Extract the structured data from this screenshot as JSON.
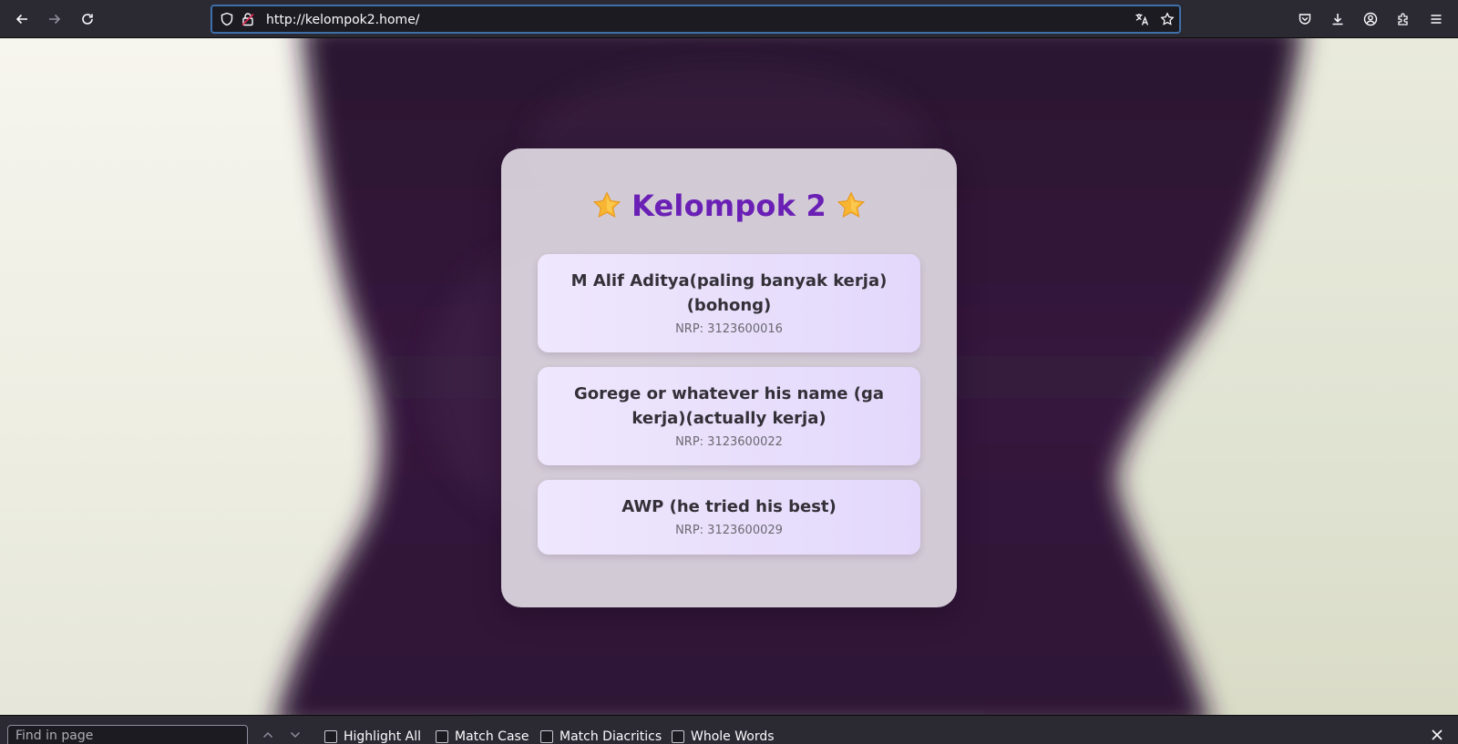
{
  "browser": {
    "url": "http://kelompok2.home/",
    "icons": {
      "back": "back-arrow-icon",
      "forward": "forward-arrow-icon",
      "reload": "reload-icon",
      "shield": "tracking-shield-icon",
      "lock": "insecure-lock-icon",
      "translate": "translate-icon",
      "bookmark": "bookmark-star-icon",
      "pocket": "pocket-icon",
      "downloads": "downloads-icon",
      "account": "account-icon",
      "extensions": "extensions-icon",
      "menu": "hamburger-menu-icon"
    }
  },
  "page": {
    "title": "Kelompok 2",
    "title_color": "#6a1fb5",
    "title_decoration": "star-emoji",
    "members": [
      {
        "name": "M Alif Aditya(paling banyak kerja)(bohong)",
        "nrp": "NRP: 3123600016"
      },
      {
        "name": "Gorege or whatever his name (ga kerja)(actually kerja)",
        "nrp": "NRP: 3123600022"
      },
      {
        "name": "AWP (he tried his best)",
        "nrp": "NRP: 3123600029"
      }
    ]
  },
  "findbar": {
    "placeholder": "Find in page",
    "options": {
      "highlight_all": "Highlight All",
      "match_case": "Match Case",
      "match_diacritics": "Match Diacritics",
      "whole_words": "Whole Words"
    }
  }
}
